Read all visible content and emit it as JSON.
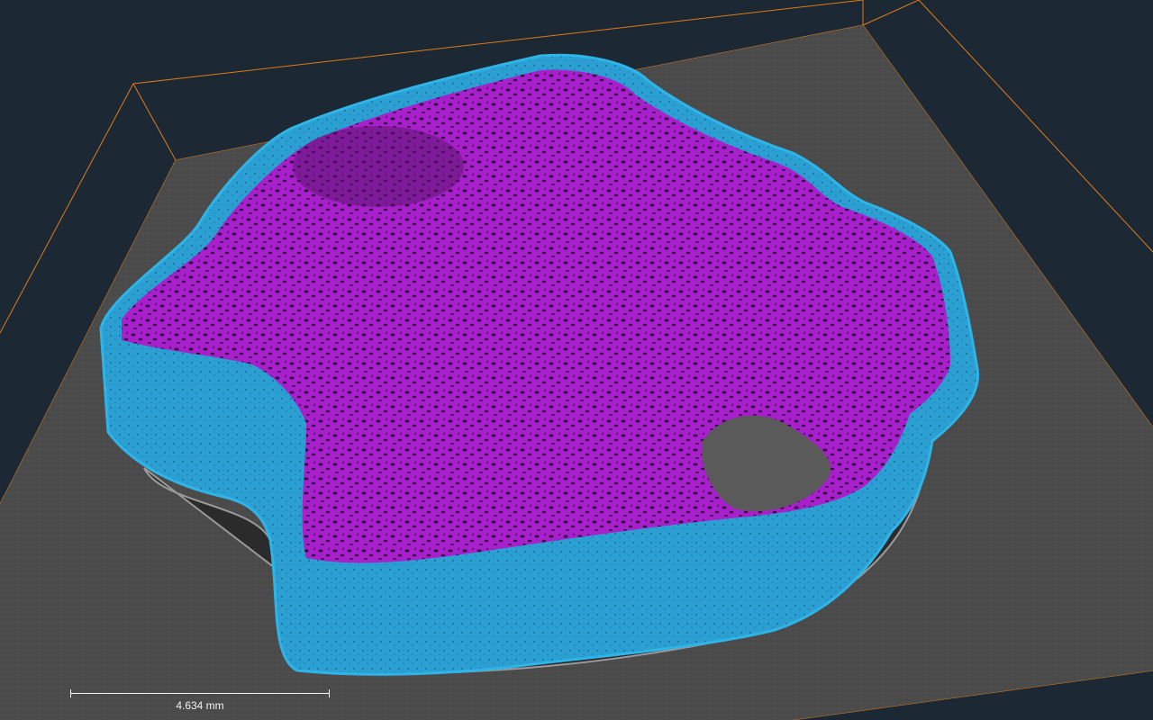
{
  "viewer": {
    "background_color": "#1c2833",
    "bounding_box_color": "#e07b17",
    "slice_color": "#4a4a4a",
    "cortical_bone_color": "#2aa7da",
    "trabecular_bone_color": "#a21fc8",
    "scale_bar": {
      "label": "4.634 mm"
    }
  }
}
